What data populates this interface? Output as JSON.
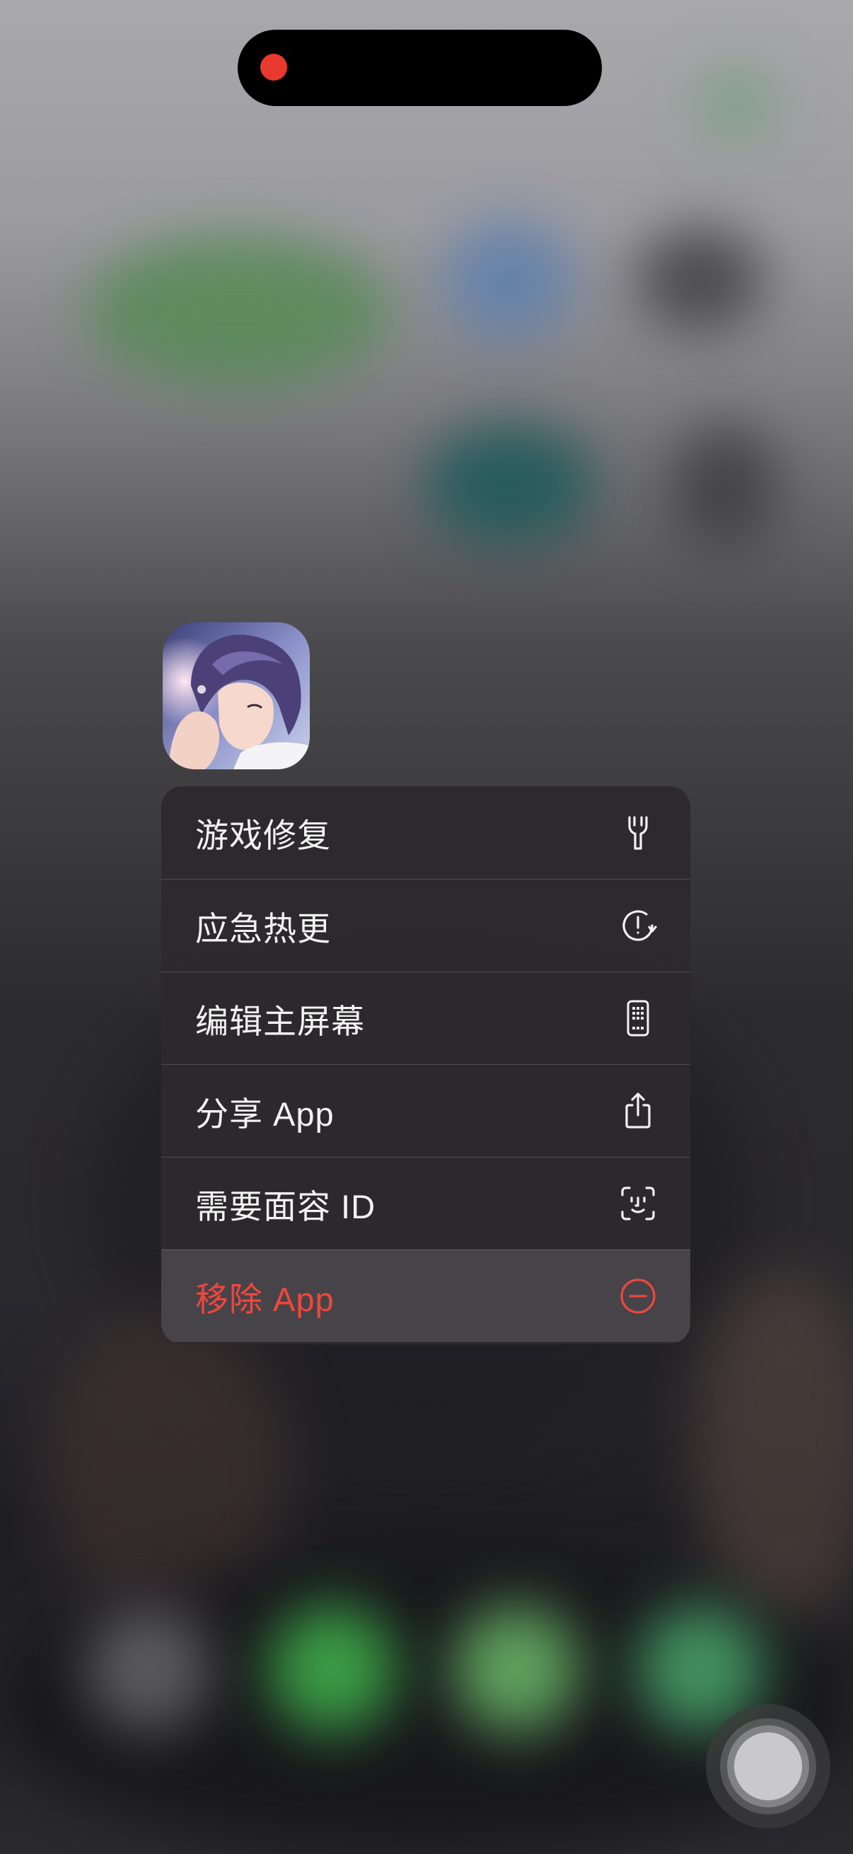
{
  "status_bar": {
    "recording_indicator": "red-dot-icon"
  },
  "app": {
    "icon": "game-app-icon"
  },
  "context_menu": {
    "items": [
      {
        "label": "游戏修复",
        "icon": "wrench-icon",
        "destructive": false
      },
      {
        "label": "应急热更",
        "icon": "exclamation-refresh-icon",
        "destructive": false
      },
      {
        "label": "编辑主屏幕",
        "icon": "phone-grid-icon",
        "destructive": false
      },
      {
        "label": "分享 App",
        "icon": "share-icon",
        "destructive": false
      },
      {
        "label": "需要面容 ID",
        "icon": "face-id-icon",
        "destructive": false
      },
      {
        "label": "移除 App",
        "icon": "minus-circle-icon",
        "destructive": true
      }
    ]
  },
  "colors": {
    "destructive": "#f0463d",
    "menu_text": "#f2f2f2",
    "recording": "#e8392f"
  },
  "assistive_touch": {
    "icon": "assistive-touch-icon"
  }
}
